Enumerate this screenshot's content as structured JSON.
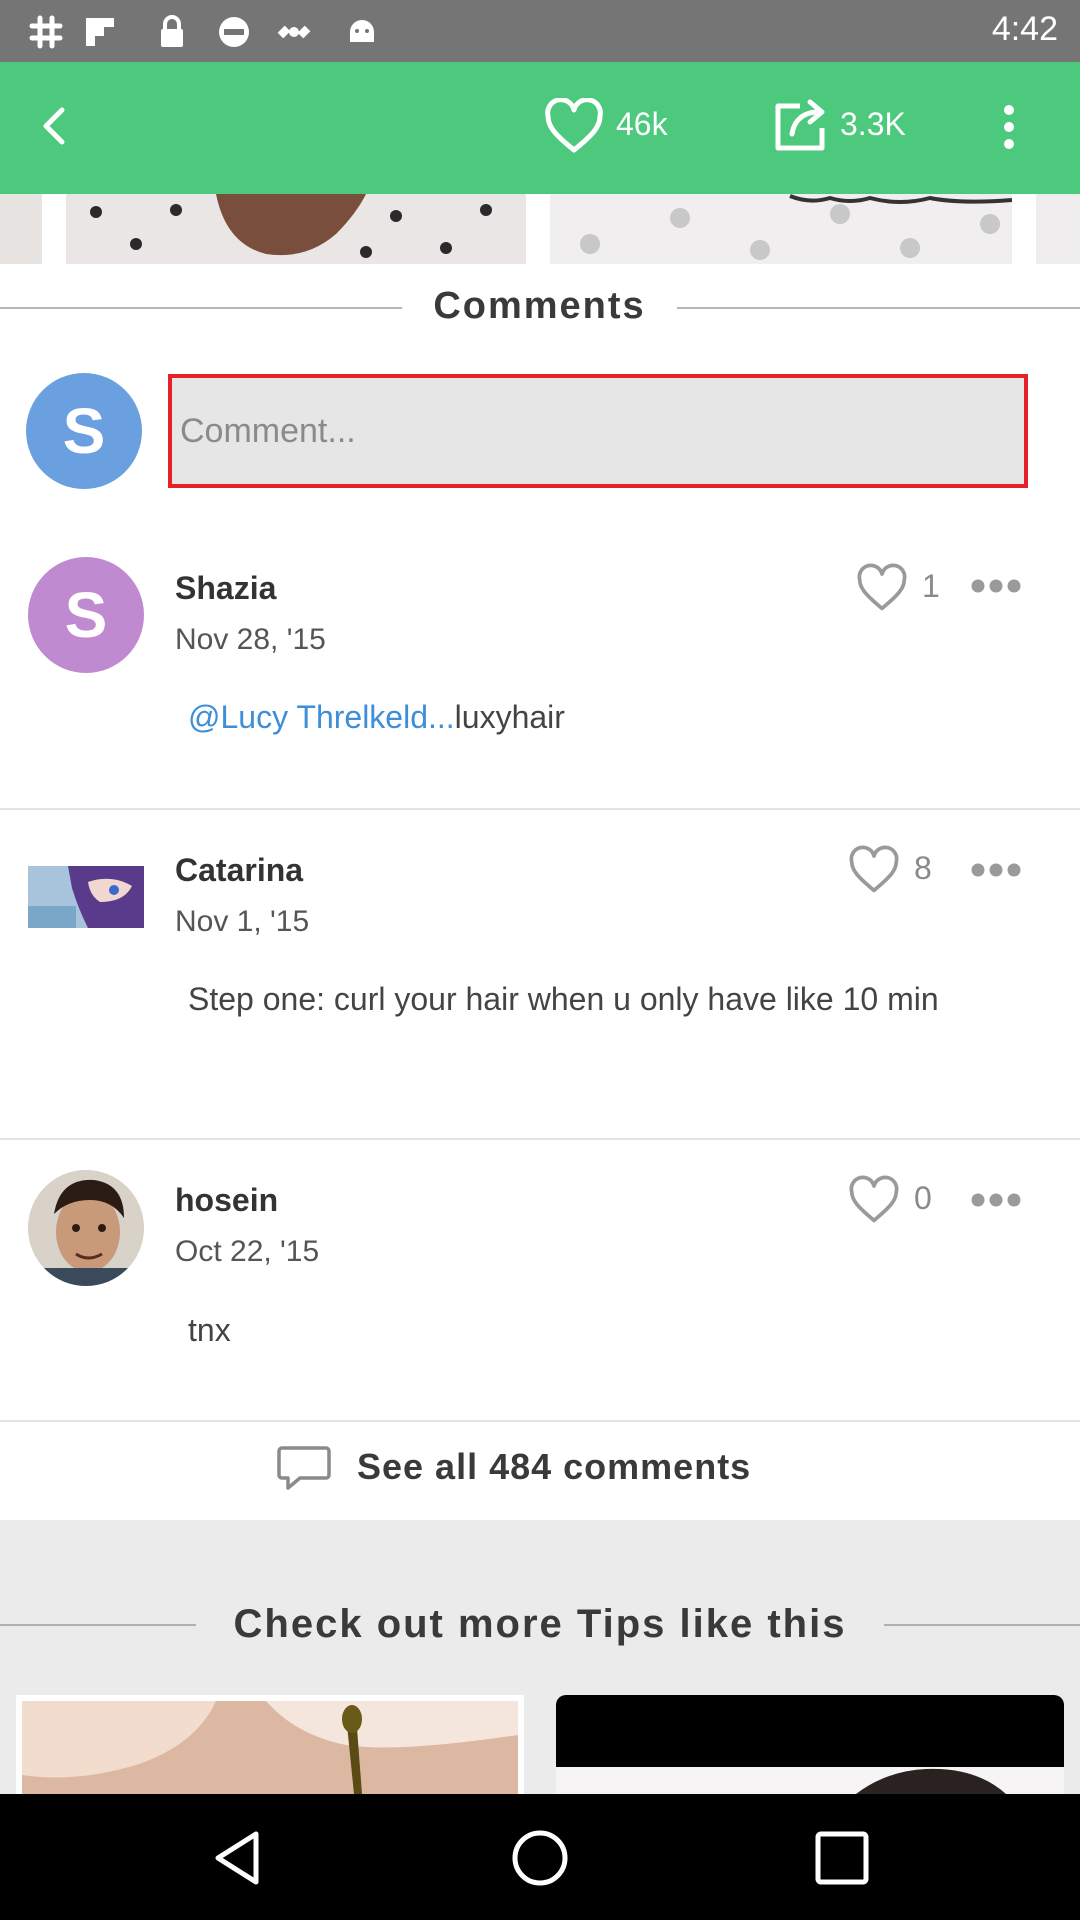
{
  "status_bar": {
    "time": "4:42",
    "icons": [
      "slack-icon",
      "flipboard-icon",
      "lock-icon",
      "no-entry-icon",
      "satellite-icon",
      "android-icon"
    ]
  },
  "app_bar": {
    "likes_count": "46k",
    "shares_count": "3.3K"
  },
  "comments_section": {
    "title": "Comments",
    "current_user_initial": "S",
    "input_placeholder": "Comment..."
  },
  "comments": [
    {
      "name": "Shazia",
      "date": "Nov 28, '15",
      "likes": "1",
      "avatar_initial": "S",
      "mention": "@Lucy Threlkeld...",
      "text": "luxyhair"
    },
    {
      "name": "Catarina",
      "date": "Nov 1, '15",
      "likes": "8",
      "text": "Step one: curl your hair when u only have like 10 min"
    },
    {
      "name": "hosein",
      "date": "Oct 22, '15",
      "likes": "0",
      "text": "tnx"
    }
  ],
  "see_all": {
    "label": "See all 484 comments"
  },
  "more_tips": {
    "title": "Check out more Tips like this"
  },
  "colors": {
    "app_bar": "#4cc97c",
    "status_bar": "#757575",
    "input_border": "#e8202a",
    "mention": "#3e8ed8",
    "avatar_user": "#6a9fe0",
    "avatar_shazia": "#c08ad0"
  }
}
